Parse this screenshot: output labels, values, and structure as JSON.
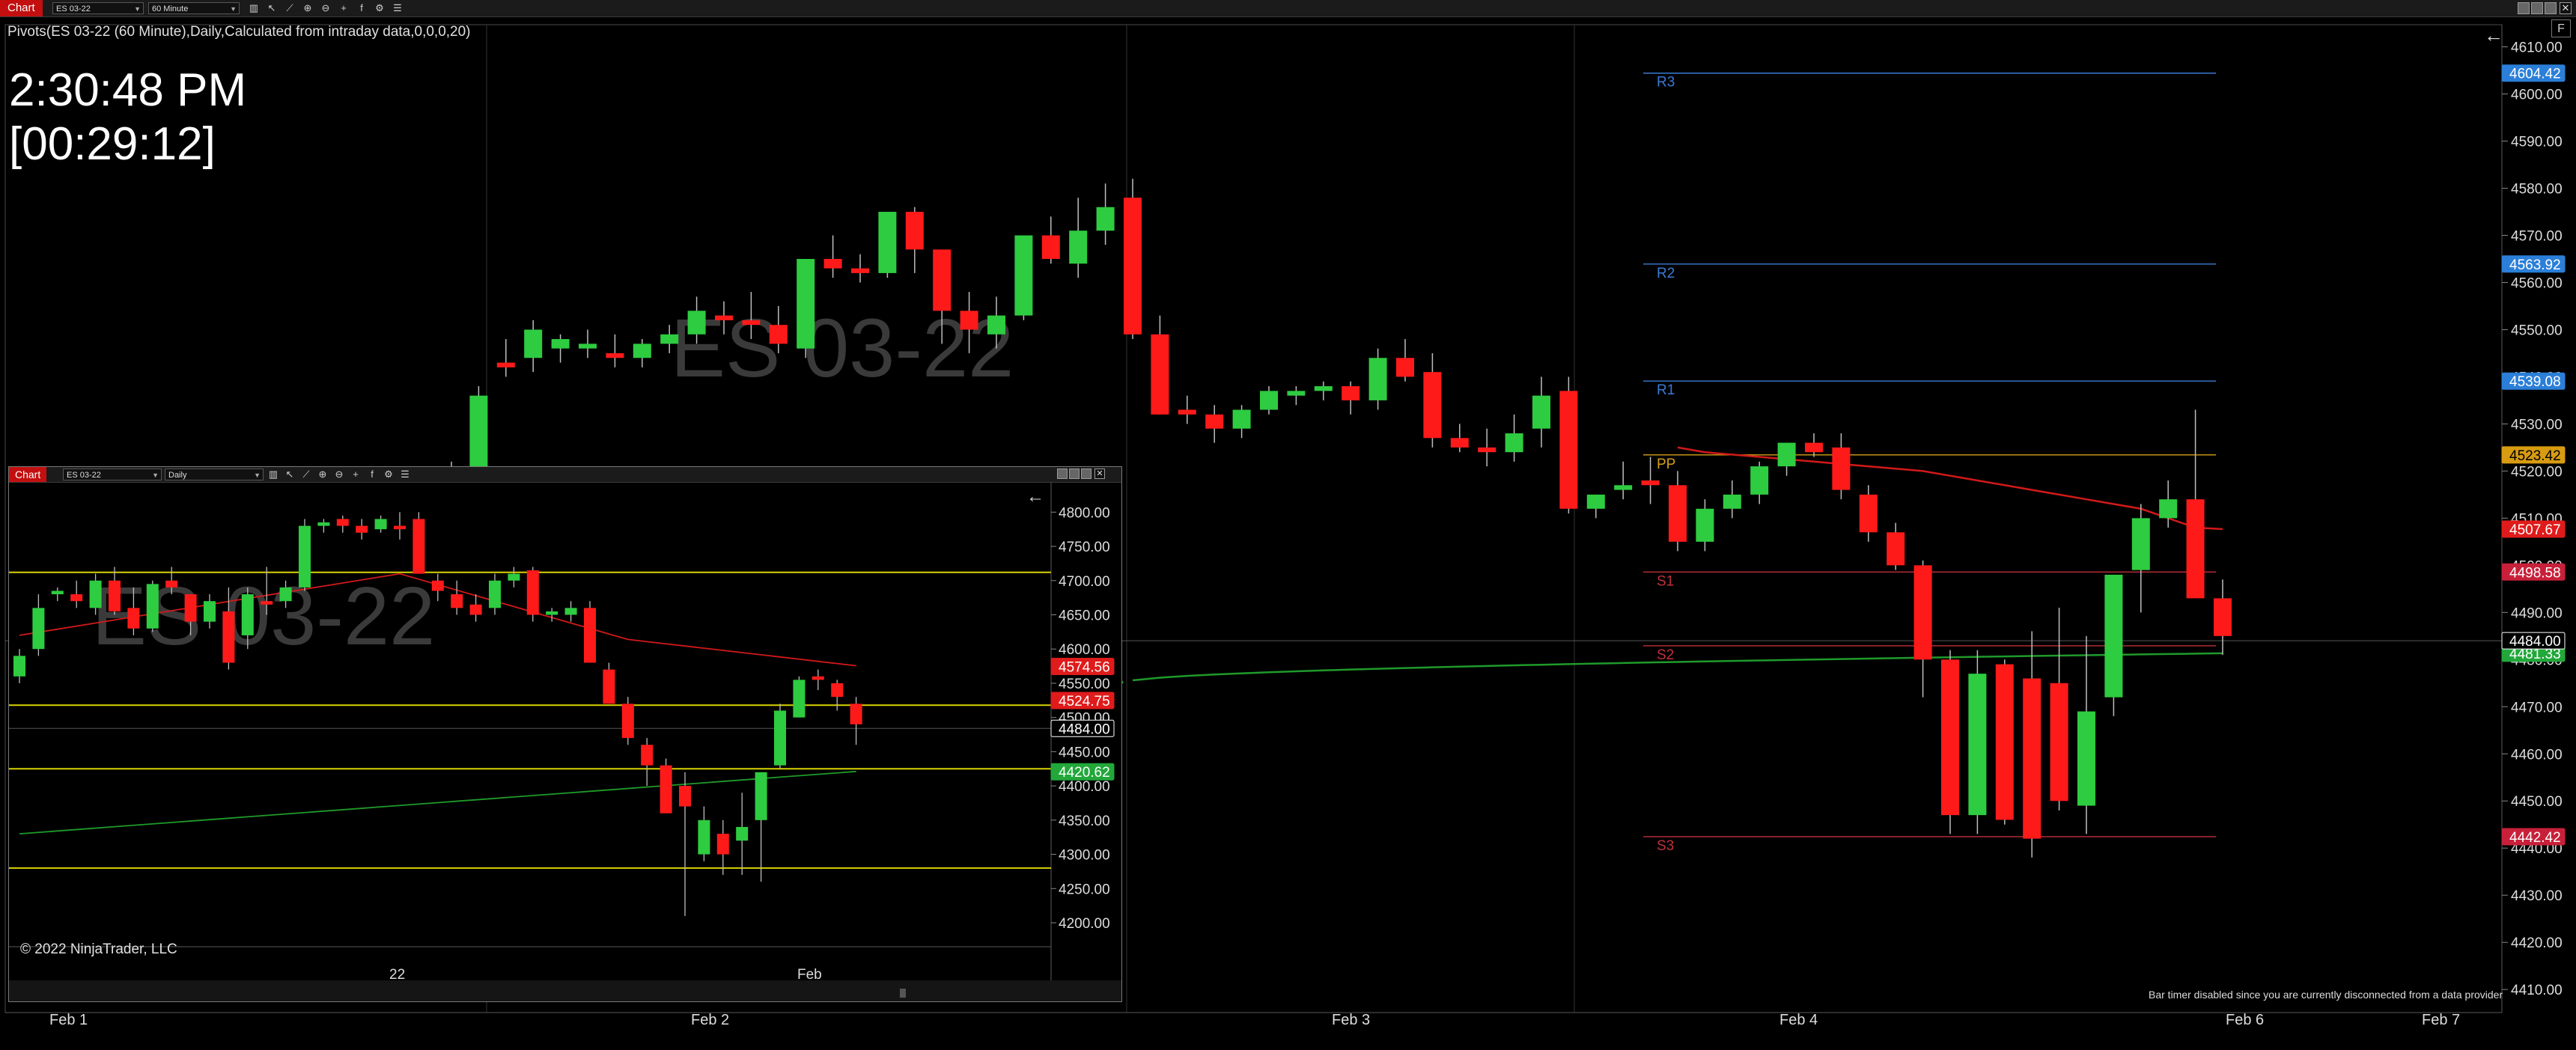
{
  "toolbar": {
    "chart_tab": "Chart",
    "instrument": "ES 03-22",
    "interval": "60 Minute",
    "tools": [
      {
        "name": "bar-type-icon",
        "glyph": "▥"
      },
      {
        "name": "cursor-icon",
        "glyph": "↖"
      },
      {
        "name": "draw-line-icon",
        "glyph": "⟋"
      },
      {
        "name": "zoom-in-icon",
        "glyph": "⊕"
      },
      {
        "name": "zoom-out-icon",
        "glyph": "⊖"
      },
      {
        "name": "crosshair-icon",
        "glyph": "+"
      },
      {
        "name": "indicators-icon",
        "glyph": "f"
      },
      {
        "name": "strategies-icon",
        "glyph": "⚙"
      },
      {
        "name": "properties-icon",
        "glyph": "☰"
      }
    ],
    "close_glyph": "✕"
  },
  "main": {
    "indicator_header": "Pivots(ES 03-22 (60 Minute),Daily,Calculated from intraday data,0,0,0,20)",
    "watermark": "ES 03-22",
    "clock": "2:30:48 PM",
    "bar_timer": "[00:29:12]",
    "f_button": "F",
    "back_arrow": "←",
    "status_note": "Bar timer disabled since you are currently disconnected from a data provider",
    "time_axis": [
      "Feb 1",
      "Feb 2",
      "Feb 3",
      "Feb 4",
      "Feb 6",
      "Feb 7"
    ],
    "colors": {
      "up": "#2ecc40",
      "down": "#ff1a1a",
      "pivot_blue": "#3a7bd5",
      "pivot_gold": "#d4a017",
      "pivot_red": "#c0303a",
      "sma_fast": "#d21919",
      "sma_slow": "#1f9a2a"
    }
  },
  "chart_data": [
    {
      "type": "candlestick",
      "title": "ES 03-22",
      "interval": "60 Minute",
      "y_ticks": [
        4410,
        4420,
        4430,
        4440,
        4450,
        4460,
        4470,
        4480,
        4490,
        4500,
        4510,
        4520,
        4530,
        4540,
        4550,
        4560,
        4570,
        4580,
        4590,
        4600,
        4610
      ],
      "y_tick_labels": [
        "4410.00",
        "4420.00",
        "4430.00",
        "4440.00",
        "4450.00",
        "4460.00",
        "4470.00",
        "4480.00",
        "4490.00",
        "4500.00",
        "4510.00",
        "4520.00",
        "4530.00",
        "4540.00",
        "4550.00",
        "4560.00",
        "4570.00",
        "4580.00",
        "4590.00",
        "4600.00",
        "4610.00"
      ],
      "ylim": [
        4405.1,
        4614.7
      ],
      "x_labels": [
        "Feb 1",
        "Feb 2",
        "Feb 3",
        "Feb 4",
        "Feb 6",
        "Feb 7"
      ],
      "candles": [
        [
          4510,
          4522,
          4507,
          4521
        ],
        [
          4521,
          4538,
          4519,
          4536
        ],
        [
          4543,
          4548,
          4540,
          4542
        ],
        [
          4544,
          4552,
          4541,
          4550
        ],
        [
          4546,
          4549,
          4543,
          4548
        ],
        [
          4546,
          4550,
          4544,
          4547
        ],
        [
          4545,
          4549,
          4542,
          4544
        ],
        [
          4544,
          4548,
          4542,
          4547
        ],
        [
          4547,
          4551,
          4545,
          4549
        ],
        [
          4549,
          4557,
          4547,
          4554
        ],
        [
          4553,
          4556,
          4549,
          4552
        ],
        [
          4552,
          4558,
          4548,
          4551
        ],
        [
          4551,
          4555,
          4545,
          4547
        ],
        [
          4546,
          4564,
          4544,
          4565
        ],
        [
          4565,
          4570,
          4561,
          4563
        ],
        [
          4563,
          4566,
          4560,
          4562
        ],
        [
          4562,
          4575,
          4561,
          4575
        ],
        [
          4575,
          4576,
          4562,
          4567
        ],
        [
          4567,
          4567,
          4547,
          4554
        ],
        [
          4554,
          4558,
          4545,
          4550
        ],
        [
          4549,
          4557,
          4546,
          4553
        ],
        [
          4553,
          4570,
          4552,
          4570
        ],
        [
          4570,
          4574,
          4564,
          4565
        ],
        [
          4564,
          4578,
          4561,
          4571
        ],
        [
          4571,
          4581,
          4568,
          4576
        ],
        [
          4578,
          4582,
          4548,
          4549
        ],
        [
          4549,
          4553,
          4532,
          4532
        ],
        [
          4533,
          4536,
          4530,
          4532
        ],
        [
          4532,
          4534,
          4526,
          4529
        ],
        [
          4529,
          4534,
          4527,
          4533
        ],
        [
          4533,
          4538,
          4532,
          4537
        ],
        [
          4536,
          4538,
          4534,
          4537
        ],
        [
          4537,
          4539,
          4535,
          4538
        ],
        [
          4538,
          4539,
          4532,
          4535
        ],
        [
          4535,
          4546,
          4533,
          4544
        ],
        [
          4544,
          4548,
          4539,
          4540
        ],
        [
          4541,
          4545,
          4525,
          4527
        ],
        [
          4527,
          4530,
          4524,
          4525
        ],
        [
          4525,
          4529,
          4521,
          4524
        ],
        [
          4524,
          4532,
          4522,
          4528
        ],
        [
          4529,
          4540,
          4525,
          4536
        ],
        [
          4537,
          4540,
          4511,
          4512
        ],
        [
          4512,
          4515,
          4510,
          4515
        ],
        [
          4516,
          4522,
          4514,
          4517
        ],
        [
          4518,
          4523,
          4513,
          4517
        ],
        [
          4517,
          4520,
          4503,
          4505
        ],
        [
          4505,
          4514,
          4503,
          4512
        ],
        [
          4512,
          4518,
          4510,
          4515
        ],
        [
          4515,
          4522,
          4513,
          4521
        ],
        [
          4521,
          4526,
          4519,
          4526
        ],
        [
          4526,
          4528,
          4523,
          4524
        ],
        [
          4525,
          4528,
          4514,
          4516
        ],
        [
          4515,
          4517,
          4505,
          4507
        ],
        [
          4507,
          4509,
          4499,
          4500
        ],
        [
          4500,
          4501,
          4472,
          4480
        ],
        [
          4480,
          4482,
          4443,
          4447
        ],
        [
          4447,
          4482,
          4443,
          4477
        ],
        [
          4479,
          4480,
          4445,
          4446
        ],
        [
          4476,
          4486,
          4438,
          4442
        ],
        [
          4475,
          4491,
          4448,
          4450
        ],
        [
          4449,
          4485,
          4443,
          4469
        ],
        [
          4472,
          4498,
          4468,
          4498
        ],
        [
          4499,
          4513,
          4490,
          4510
        ],
        [
          4510,
          4518,
          4508,
          4514
        ],
        [
          4514,
          4533,
          4498,
          4493
        ],
        [
          4493,
          4497,
          4481,
          4485
        ]
      ],
      "pivots": [
        {
          "name": "R3",
          "value": 4604.42
        },
        {
          "name": "R2",
          "value": 4563.92
        },
        {
          "name": "R1",
          "value": 4539.08
        },
        {
          "name": "PP",
          "value": 4523.42
        },
        {
          "name": "S1",
          "value": 4498.58
        },
        {
          "name": "S2",
          "value": 4482.92
        },
        {
          "name": "S3",
          "value": 4442.42
        }
      ],
      "price_flags": [
        {
          "label": "4604.42",
          "value": 4604.42,
          "color": "#2b7fd8",
          "text": "#fff"
        },
        {
          "label": "4563.92",
          "value": 4563.92,
          "color": "#2b7fd8",
          "text": "#fff"
        },
        {
          "label": "4539.08",
          "value": 4539.08,
          "color": "#2b7fd8",
          "text": "#fff"
        },
        {
          "label": "4523.42",
          "value": 4523.42,
          "color": "#d89c12",
          "text": "#000"
        },
        {
          "label": "4507.67",
          "value": 4507.67,
          "color": "#e01b1b",
          "text": "#fff"
        },
        {
          "label": "4498.58",
          "value": 4498.58,
          "color": "#c8203a",
          "text": "#fff"
        },
        {
          "label": "4481.33",
          "value": 4481.33,
          "color": "#22a83a",
          "text": "#fff"
        },
        {
          "label": "4484.00",
          "value": 4484.0,
          "color": "#000",
          "text": "#fff",
          "border": "#fff"
        },
        {
          "label": "4442.42",
          "value": 4442.42,
          "color": "#c8203a",
          "text": "#fff"
        }
      ],
      "sma_fast_tail": [
        4525,
        4524,
        4523.5,
        4523,
        4522.5,
        4522,
        4521.5,
        4521,
        4520.5,
        4520,
        4519,
        4518,
        4517,
        4516,
        4515,
        4514,
        4513,
        4512,
        4510,
        4508,
        4507.67
      ],
      "sma_slow_span": [
        4475,
        4481.33
      ],
      "last_price": 4484.0
    },
    {
      "type": "candlestick",
      "title": "ES 03-22",
      "interval": "Daily",
      "y_ticks": [
        4200,
        4250,
        4300,
        4350,
        4400,
        4450,
        4500,
        4550,
        4600,
        4650,
        4700,
        4750,
        4800
      ],
      "y_tick_labels": [
        "4200.00",
        "4250.00",
        "4300.00",
        "4350.00",
        "4400.00",
        "4450.00",
        "4500.00",
        "4550.00",
        "4600.00",
        "4650.00",
        "4700.00",
        "4750.00",
        "4800.00"
      ],
      "ylim": [
        4165,
        4843
      ],
      "x_labels": [
        "22",
        "Feb"
      ],
      "candles": [
        [
          4560,
          4600,
          4550,
          4590
        ],
        [
          4600,
          4680,
          4590,
          4660
        ],
        [
          4680,
          4690,
          4670,
          4685
        ],
        [
          4680,
          4700,
          4660,
          4670
        ],
        [
          4660,
          4710,
          4650,
          4700
        ],
        [
          4700,
          4720,
          4650,
          4655
        ],
        [
          4660,
          4690,
          4620,
          4630
        ],
        [
          4630,
          4700,
          4625,
          4695
        ],
        [
          4700,
          4720,
          4680,
          4690
        ],
        [
          4680,
          4680,
          4620,
          4640
        ],
        [
          4640,
          4680,
          4630,
          4670
        ],
        [
          4655,
          4690,
          4570,
          4580
        ],
        [
          4620,
          4690,
          4600,
          4680
        ],
        [
          4670,
          4720,
          4650,
          4665
        ],
        [
          4670,
          4700,
          4660,
          4690
        ],
        [
          4690,
          4790,
          4685,
          4780
        ],
        [
          4780,
          4790,
          4770,
          4785
        ],
        [
          4790,
          4795,
          4770,
          4780
        ],
        [
          4780,
          4790,
          4760,
          4770
        ],
        [
          4775,
          4795,
          4770,
          4790
        ],
        [
          4780,
          4800,
          4760,
          4775
        ],
        [
          4790,
          4800,
          4710,
          4710
        ],
        [
          4700,
          4710,
          4670,
          4685
        ],
        [
          4680,
          4700,
          4650,
          4660
        ],
        [
          4665,
          4680,
          4640,
          4650
        ],
        [
          4660,
          4710,
          4650,
          4700
        ],
        [
          4700,
          4720,
          4690,
          4710
        ],
        [
          4715,
          4720,
          4640,
          4650
        ],
        [
          4650,
          4660,
          4640,
          4655
        ],
        [
          4650,
          4670,
          4640,
          4660
        ],
        [
          4660,
          4670,
          4580,
          4580
        ],
        [
          4570,
          4580,
          4520,
          4520
        ],
        [
          4520,
          4530,
          4460,
          4470
        ],
        [
          4460,
          4470,
          4400,
          4430
        ],
        [
          4430,
          4440,
          4360,
          4360
        ],
        [
          4400,
          4420,
          4210,
          4370
        ],
        [
          4300,
          4370,
          4290,
          4350
        ],
        [
          4330,
          4350,
          4270,
          4300
        ],
        [
          4320,
          4390,
          4270,
          4340
        ],
        [
          4350,
          4420,
          4260,
          4420
        ],
        [
          4430,
          4520,
          4425,
          4510
        ],
        [
          4500,
          4560,
          4500,
          4555
        ],
        [
          4560,
          4570,
          4540,
          4555
        ],
        [
          4550,
          4555,
          4510,
          4530
        ],
        [
          4520,
          4530,
          4460,
          4490
        ]
      ],
      "horizontal_lines": [
        4712,
        4518,
        4425,
        4280
      ],
      "price_flags": [
        {
          "label": "4574.56",
          "value": 4574.56,
          "color": "#e01b1b",
          "text": "#fff"
        },
        {
          "label": "4524.75",
          "value": 4524.75,
          "color": "#e01b1b",
          "text": "#fff"
        },
        {
          "label": "4484.00",
          "value": 4484.0,
          "color": "#000",
          "text": "#fff",
          "border": "#fff"
        },
        {
          "label": "4420.62",
          "value": 4420.62,
          "color": "#22a83a",
          "text": "#fff"
        }
      ],
      "last_price": 4484.0
    }
  ],
  "inset": {
    "chart_tab": "Chart",
    "instrument": "ES 03-22",
    "interval": "Daily",
    "copyright": "© 2022 NinjaTrader, LLC",
    "time_axis": [
      "22",
      "Feb"
    ],
    "back_arrow": "←"
  }
}
